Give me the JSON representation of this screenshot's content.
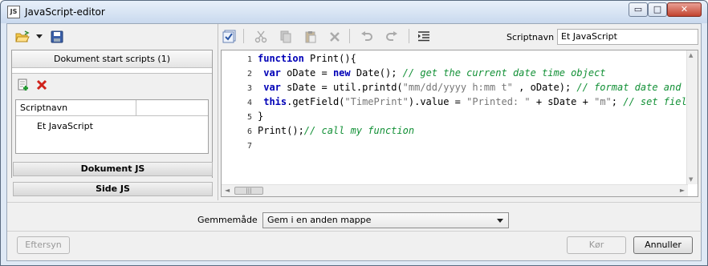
{
  "window": {
    "title": "JavaScript-editor",
    "app_icon_text": "JS",
    "controls": {
      "minimize": "▭",
      "maximize": "□",
      "close": "✕"
    }
  },
  "left": {
    "toolbar_icons": [
      "folder-open-icon",
      "dropdown-arrow-icon",
      "save-icon"
    ],
    "panel_title": "Dokument start scripts (1)",
    "list_icons": [
      "add-script-icon",
      "delete-script-icon"
    ],
    "column_header": "Scriptnavn",
    "scripts": [
      "Et JavaScript"
    ],
    "doc_js_label": "Dokument JS",
    "page_js_label": "Side JS"
  },
  "editor_toolbar": {
    "icons": [
      "check-syntax-icon",
      "cut-icon",
      "copy-icon",
      "paste-icon",
      "delete-icon",
      "undo-icon",
      "redo-icon",
      "indent-icon"
    ],
    "scriptname_label": "Scriptnavn",
    "scriptname_value": "Et JavaScript"
  },
  "code": {
    "line_numbers": [
      "1",
      "2",
      "3",
      "4",
      "5",
      "6",
      "7"
    ],
    "colors": {
      "keyword": "#0000b7",
      "comment": "#129036",
      "string": "#777777"
    },
    "lines": [
      [
        {
          "t": "function",
          "c": "kw"
        },
        {
          "t": " Print(){",
          "c": ""
        }
      ],
      [
        {
          "t": " ",
          "c": ""
        },
        {
          "t": "var",
          "c": "kw"
        },
        {
          "t": " oDate = ",
          "c": ""
        },
        {
          "t": "new",
          "c": "kw"
        },
        {
          "t": " Date(); ",
          "c": ""
        },
        {
          "t": "// get the current date time object",
          "c": "cm"
        }
      ],
      [
        {
          "t": " ",
          "c": ""
        },
        {
          "t": "var",
          "c": "kw"
        },
        {
          "t": " sDate = util.printd(",
          "c": ""
        },
        {
          "t": "\"mm/dd/yyyy h:mm t\"",
          "c": "str"
        },
        {
          "t": " , oDate); ",
          "c": ""
        },
        {
          "t": "// format date and time",
          "c": "cm"
        }
      ],
      [
        {
          "t": " ",
          "c": ""
        },
        {
          "t": "this",
          "c": "kw"
        },
        {
          "t": ".getField(",
          "c": ""
        },
        {
          "t": "\"TimePrint\"",
          "c": "str"
        },
        {
          "t": ").value = ",
          "c": ""
        },
        {
          "t": "\"Printed: \"",
          "c": "str"
        },
        {
          "t": " + sDate + ",
          "c": ""
        },
        {
          "t": "\"m\"",
          "c": "str"
        },
        {
          "t": "; ",
          "c": ""
        },
        {
          "t": "// set field",
          "c": "cm"
        }
      ],
      [
        {
          "t": "}",
          "c": ""
        }
      ],
      [
        {
          "t": "Print();",
          "c": ""
        },
        {
          "t": "// call my function",
          "c": "cm"
        }
      ],
      []
    ]
  },
  "scrollbars": {
    "up": "▲",
    "down": "▼",
    "left": "◄",
    "right": "►",
    "grip": "|||"
  },
  "footer": {
    "mode_label": "Gemmemåde",
    "mode_value": "Gem i en anden mappe",
    "preview_label": "Eftersyn",
    "run_label": "Kør",
    "cancel_label": "Annuller"
  }
}
